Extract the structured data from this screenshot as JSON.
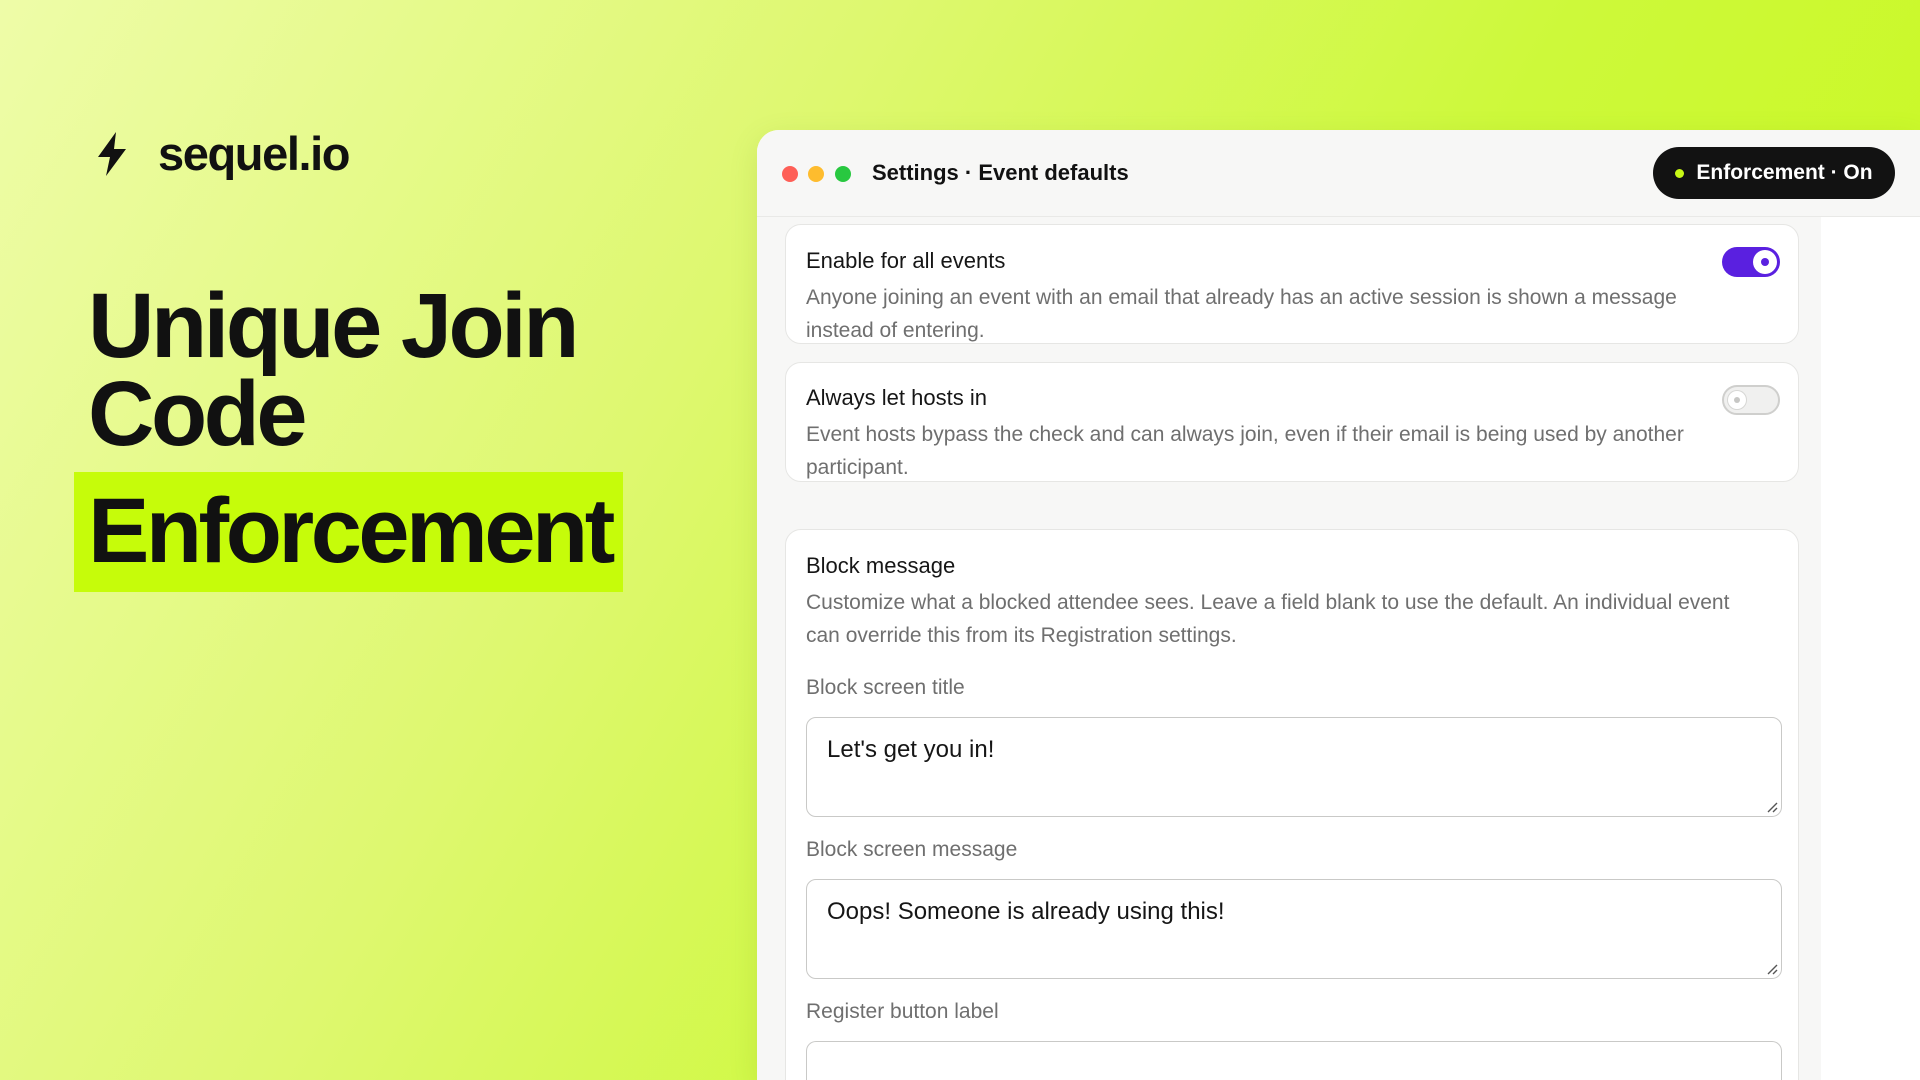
{
  "brand": {
    "name": "sequel.io",
    "icon": "bolt-icon"
  },
  "headline": {
    "line1": "Unique Join",
    "line2": "Code",
    "highlight": "Enforcement"
  },
  "window": {
    "title": "Settings · Event defaults",
    "badge": "Enforcement · On",
    "controls": [
      "close",
      "minimize",
      "maximize"
    ]
  },
  "settings": {
    "enable_all": {
      "title": "Enable for all events",
      "description": "Anyone joining an event with an email that already has an active session is shown a message instead of entering.",
      "enabled": true
    },
    "hosts_in": {
      "title": "Always let hosts in",
      "description": "Event hosts bypass the check and can always join, even if their email is being used by another participant.",
      "enabled": false
    },
    "block_message": {
      "title": "Block message",
      "description": "Customize what a blocked attendee sees. Leave a field blank to use the default. An individual event can override this from its Registration settings.",
      "fields": [
        {
          "label": "Block screen title",
          "value": "Let's get you in!"
        },
        {
          "label": "Block screen message",
          "value": "Oops! Someone is already using this!"
        },
        {
          "label": "Register button label",
          "value": ""
        }
      ]
    }
  },
  "colors": {
    "accent": "#5a20e0",
    "highlight": "#c6fc0a",
    "badge_dot": "#c8f816"
  }
}
